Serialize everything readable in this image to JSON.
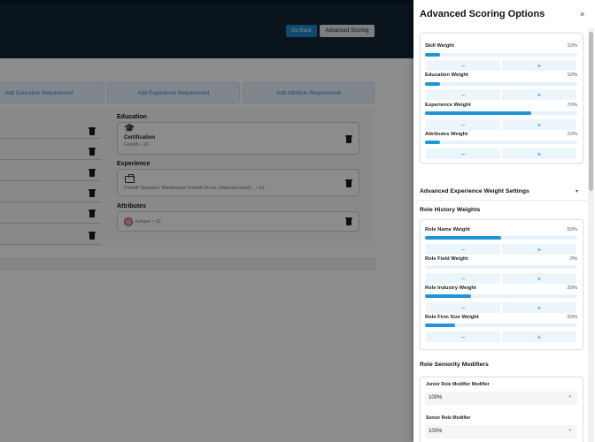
{
  "header": {
    "go_back": "Go Back",
    "advanced_scoring": "Advanced Scoring"
  },
  "add_buttons": {
    "education": "Add Education Requirement",
    "experience": "Add Experience Requirement",
    "attribute": "Add Attribute Requirement"
  },
  "requirements": {
    "education_label": "Education",
    "education_title": "Certification",
    "education_sub": "Forklift • 10",
    "experience_label": "Experience",
    "experience_sub": "Forklift Operator, Warehouse Forklift Driver, Material Handl... • 10",
    "attributes_label": "Attributes",
    "attributes_sub": "Jumper • 10"
  },
  "drawer": {
    "title": "Advanced Scoring Options",
    "close": "×",
    "weights": [
      {
        "label": "Skill Weight",
        "value": "10%",
        "fraction": 0.1
      },
      {
        "label": "Education Weight",
        "value": "10%",
        "fraction": 0.1
      },
      {
        "label": "Experience Weight",
        "value": "70%",
        "fraction": 0.7
      },
      {
        "label": "Attributes Weight",
        "value": "10%",
        "fraction": 0.1
      }
    ],
    "minus": "−",
    "plus": "+",
    "exp_settings_title": "Advanced Experience Weight Settings",
    "role_history_title": "Role History Weights",
    "role_weights": [
      {
        "label": "Role Name Weight",
        "value": "50%",
        "fraction": 0.5
      },
      {
        "label": "Role Field Weight",
        "value": "0%",
        "fraction": 0.0
      },
      {
        "label": "Role Industry Weight",
        "value": "30%",
        "fraction": 0.3
      },
      {
        "label": "Role Firm Size Weight",
        "value": "20%",
        "fraction": 0.2
      }
    ],
    "seniority_title": "Role Seniority Modifiers",
    "junior_label": "Junior Role Modifier Modifier",
    "junior_value": "100%",
    "senior_label": "Senior Role Modifier",
    "senior_value": "100%"
  },
  "icons": {
    "trash": "trash-icon",
    "graduation_cap": "graduation-cap-icon",
    "briefcase": "briefcase-icon",
    "avatar": "avatar-icon",
    "chevron_down": "chevron-down-icon",
    "close": "close-icon"
  },
  "colors": {
    "header_bg": "#112536",
    "primary": "#1e88c8",
    "accent_fill": "#1f95d6",
    "add_button_bg": "#eaf5fd"
  }
}
